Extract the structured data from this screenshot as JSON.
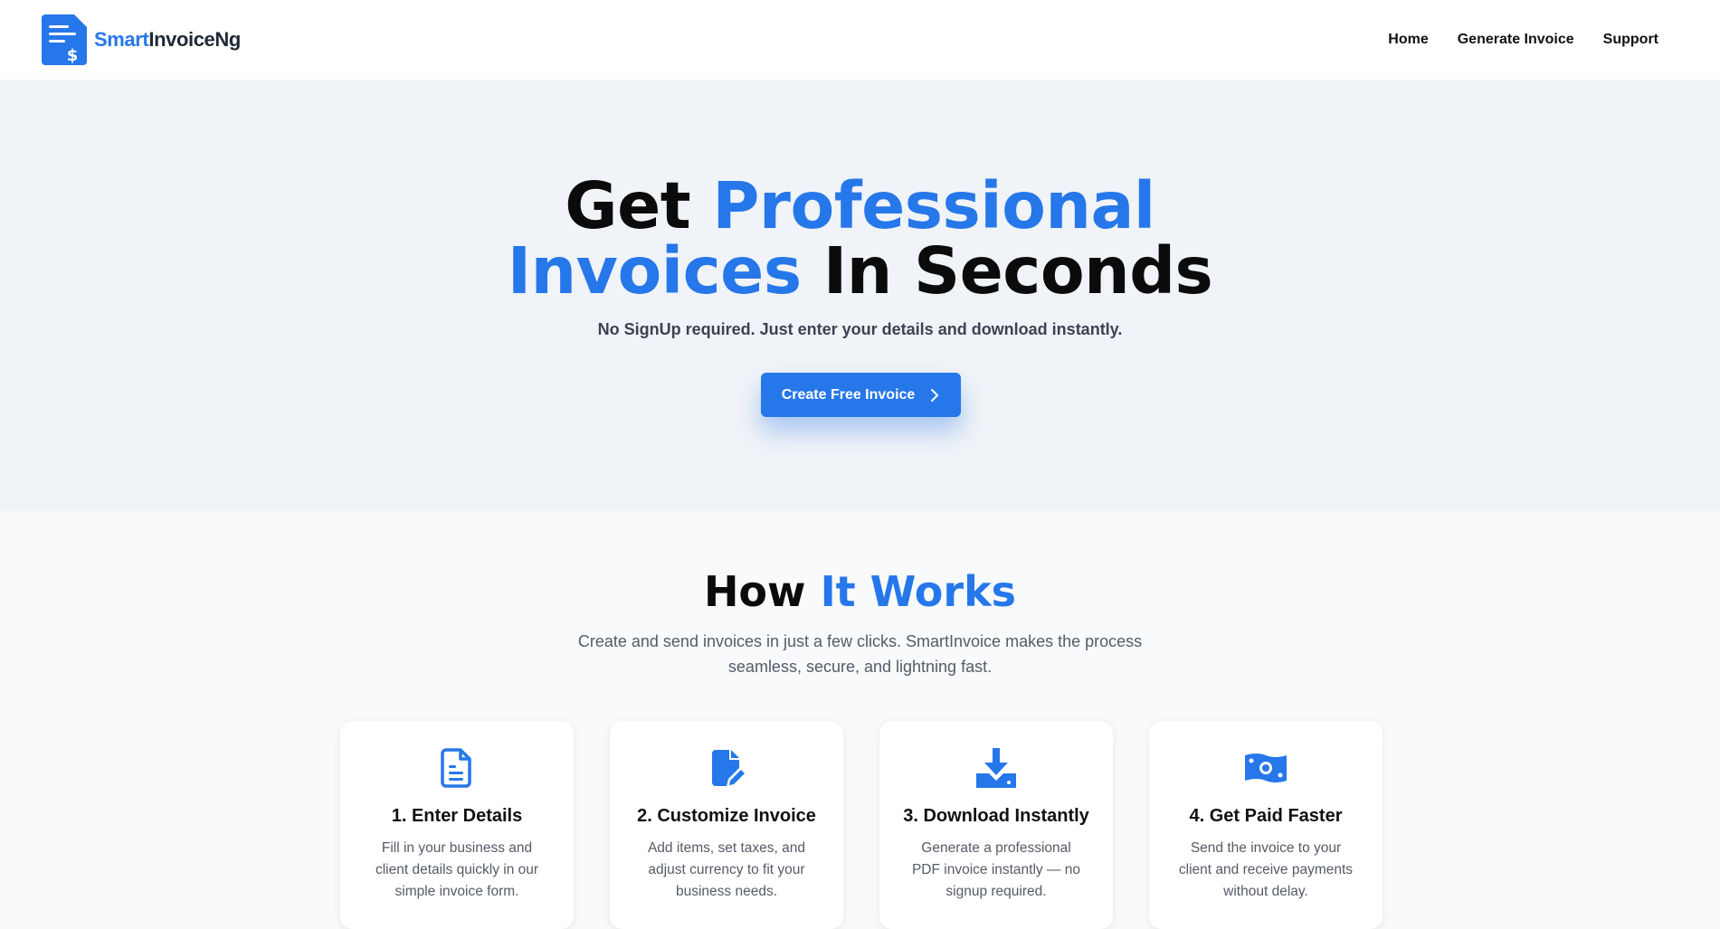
{
  "brand": {
    "part1": "Smart",
    "part2": "InvoiceNg"
  },
  "nav": {
    "home": "Home",
    "generate": "Generate Invoice",
    "support": "Support"
  },
  "hero": {
    "title_word1": "Get",
    "title_word2": "Professional",
    "title_word3": "Invoices",
    "title_word4": "In Seconds",
    "subtitle": "No SignUp required. Just enter your details and download instantly.",
    "cta_label": "Create Free Invoice"
  },
  "how": {
    "title_part1": "How",
    "title_part2": "It Works",
    "description": "Create and send invoices in just a few clicks. SmartInvoice makes the process seamless, secure, and lightning fast.",
    "cards": [
      {
        "icon": "document-icon",
        "title": "1. Enter Details",
        "text": "Fill in your business and client details quickly in our simple invoice form."
      },
      {
        "icon": "edit-document-icon",
        "title": "2. Customize Invoice",
        "text": "Add items, set taxes, and adjust currency to fit your business needs."
      },
      {
        "icon": "download-icon",
        "title": "3. Download Instantly",
        "text": "Generate a professional PDF invoice instantly — no signup required."
      },
      {
        "icon": "money-icon",
        "title": "4. Get Paid Faster",
        "text": "Send the invoice to your client and receive payments without delay."
      }
    ]
  },
  "colors": {
    "accent": "#2677e9",
    "hero_bg": "#f0f3f7",
    "page_bg": "#f8fafc"
  }
}
